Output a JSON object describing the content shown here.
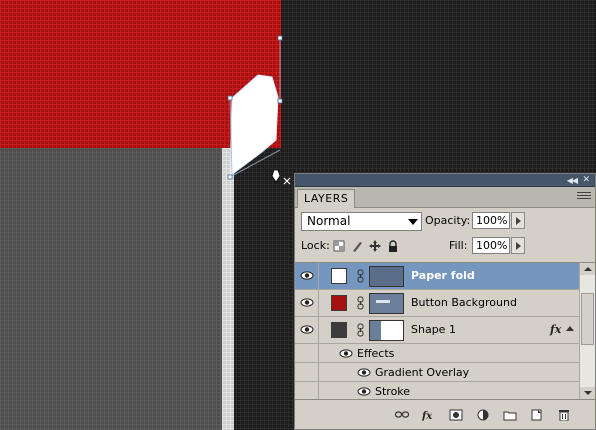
{
  "canvas": {
    "colors": {
      "red_fill": "#a51010",
      "dark_bg": "#1c1c1c",
      "gray_fill": "#4e4e4e",
      "paper_white": "#ffffff"
    }
  },
  "panel": {
    "tab_label": "LAYERS",
    "blend_mode": "Normal",
    "opacity_label": "Opacity:",
    "opacity_value": "100%",
    "lock_label": "Lock:",
    "fill_label": "Fill:",
    "fill_value": "100%",
    "layers": [
      {
        "name": "Paper fold",
        "swatch_color": "#ffffff",
        "selected": true
      },
      {
        "name": "Button Background",
        "swatch_color": "#a51010",
        "selected": false
      },
      {
        "name": "Shape 1",
        "swatch_color": "#3c3c3c",
        "selected": false,
        "fx": "fx"
      }
    ],
    "effects_label": "Effects",
    "effects": [
      "Gradient Overlay",
      "Stroke"
    ],
    "bottom_icons": [
      "link-layers-icon",
      "fx-icon",
      "layer-mask-icon",
      "adjustment-layer-icon",
      "new-group-icon",
      "new-layer-icon",
      "delete-layer-icon"
    ],
    "selection_color": "#7596bf"
  }
}
